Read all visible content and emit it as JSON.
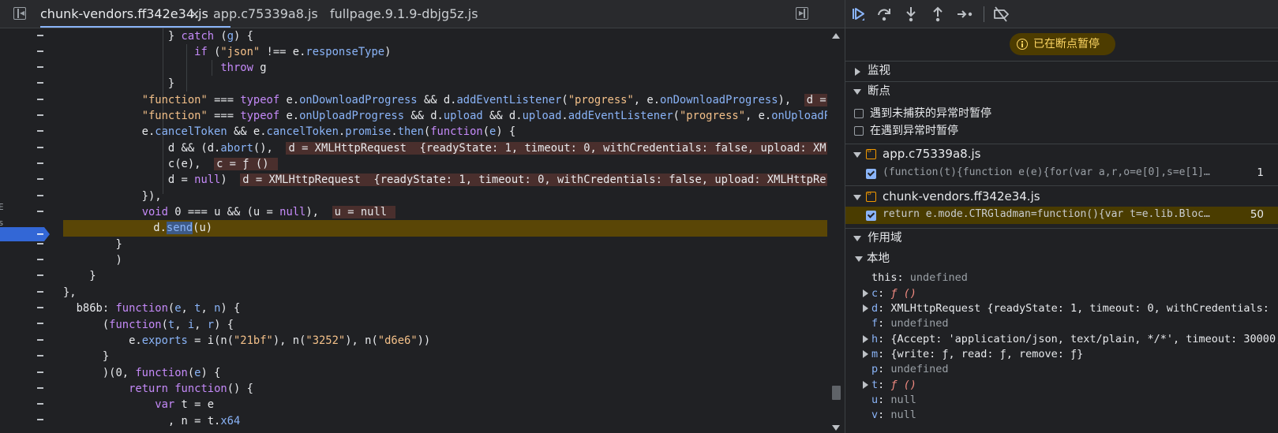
{
  "editor": {
    "tabs": [
      {
        "label": "chunk-vendors.ff342e34.js",
        "active": true
      },
      {
        "label": "app.c75339a8.js",
        "active": false
      },
      {
        "label": "fullpage.9.1.9-dbjg5z.js",
        "active": false
      }
    ],
    "close_glyph": "×",
    "breakpoint_line_label": "-",
    "left_edge_glyphs": [
      "E",
      "s"
    ]
  },
  "debugger": {
    "paused_banner": "已在断点暂停",
    "sections": {
      "watch": "监视",
      "breakpoints": "断点",
      "scope": "作用域"
    },
    "pause_options": [
      {
        "label": "遇到未捕获的异常时暂停",
        "checked": false
      },
      {
        "label": "在遇到异常时暂停",
        "checked": false
      }
    ],
    "breakpoint_files": [
      {
        "file": "app.c75339a8.js",
        "code": "(function(t){function e(e){for(var a,r,o=e[0],s=e[1],l=…",
        "line": "1",
        "checked": true
      },
      {
        "file": "chunk-vendors.ff342e34.js",
        "code": "return e.mode.CTRGladman=function(){var t=e.lib.BlockCi…",
        "line": "50",
        "checked": true,
        "highlighted": true
      }
    ],
    "scope_local_label": "本地",
    "scope_vars": [
      {
        "key": "this",
        "value": "undefined",
        "type": "gray",
        "expandable": false
      },
      {
        "key": "c",
        "value": "ƒ ()",
        "type": "fn",
        "expandable": true
      },
      {
        "key": "d",
        "value": "XMLHttpRequest  {readyState: 1, timeout: 0, withCredentials:",
        "type": "obj",
        "expandable": true
      },
      {
        "key": "f",
        "value": "undefined",
        "type": "gray",
        "expandable": false
      },
      {
        "key": "h",
        "value": "{Accept: 'application/json, text/plain, */*', timeout: 30000,",
        "type": "obj",
        "expandable": true
      },
      {
        "key": "m",
        "value": "{write: ƒ, read: ƒ, remove: ƒ}",
        "type": "obj",
        "expandable": true
      },
      {
        "key": "p",
        "value": "undefined",
        "type": "gray",
        "expandable": false
      },
      {
        "key": "t",
        "value": "ƒ ()",
        "type": "fn",
        "expandable": true
      },
      {
        "key": "u",
        "value": "null",
        "type": "gray",
        "expandable": false
      },
      {
        "key": "v",
        "value": "null",
        "type": "gray",
        "expandable": false
      }
    ]
  },
  "colors": {
    "background": "#202124",
    "keyword": "#c58af9",
    "string": "#f3c089",
    "property": "#8ab4f8",
    "breakpoint_highlight": "#5a4606",
    "paused_banner_bg": "#4d3c00",
    "paused_banner_text": "#fdd663"
  },
  "icons": [
    "toggle-navigator-icon",
    "toggle-debugger-icon",
    "resume-icon",
    "step-over-icon",
    "step-into-icon",
    "step-out-icon",
    "step-icon",
    "deactivate-breakpoints-icon",
    "info-icon",
    "file-icon"
  ]
}
